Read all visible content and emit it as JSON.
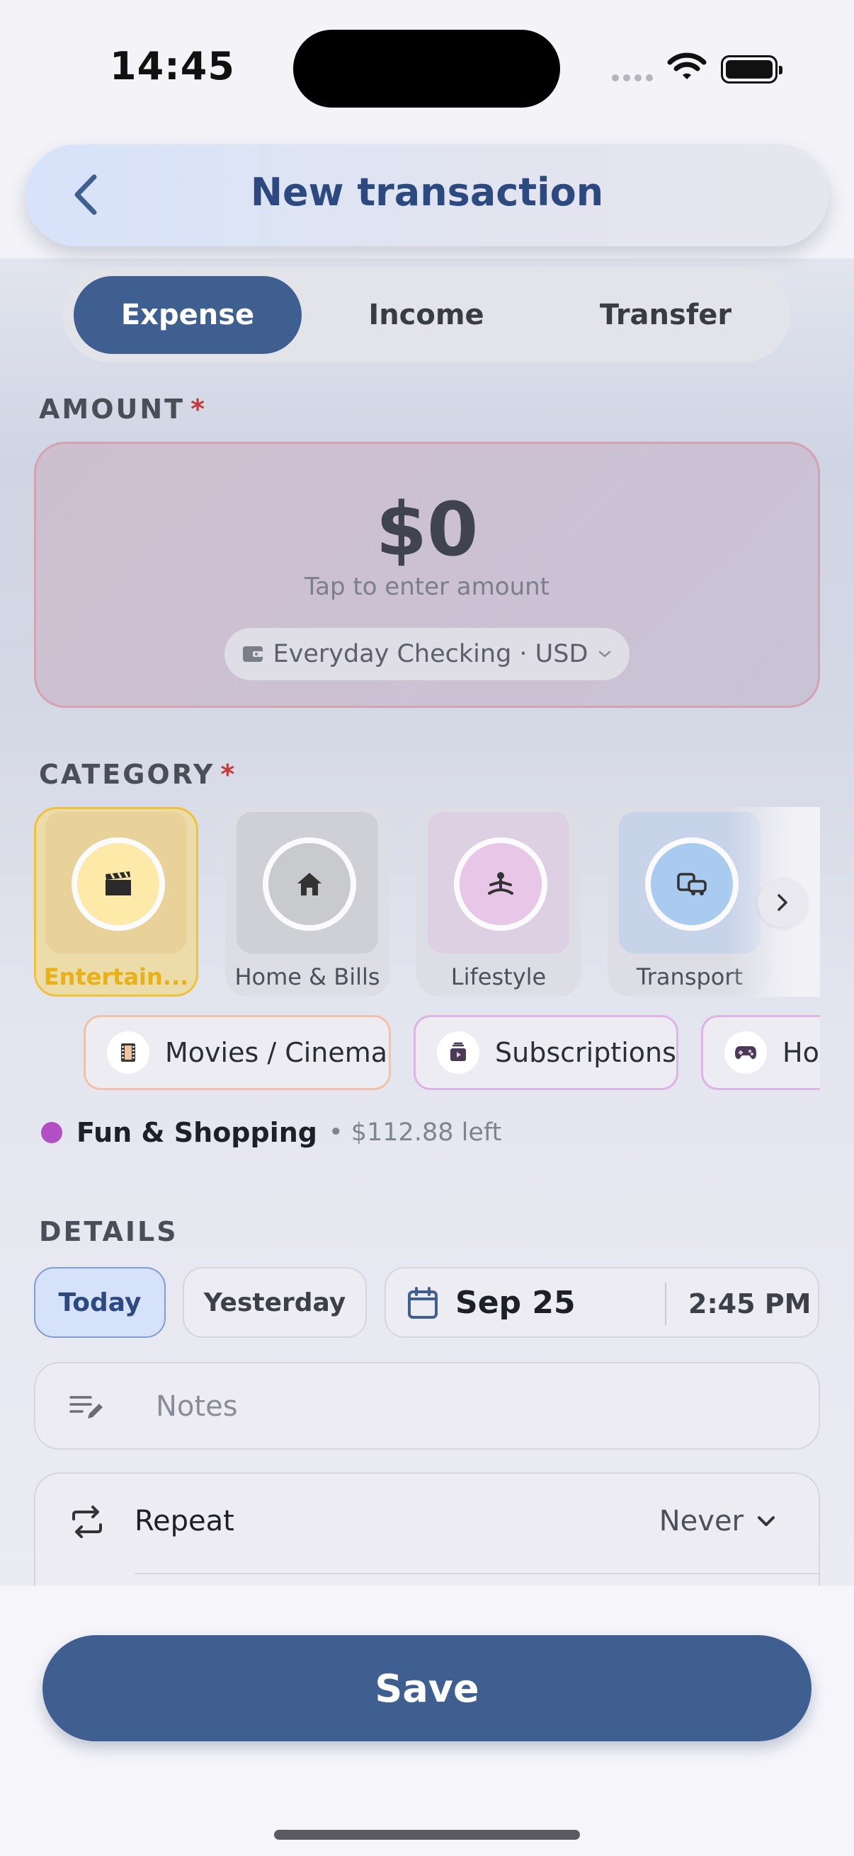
{
  "status_bar": {
    "time": "14:45"
  },
  "header": {
    "title": "New transaction"
  },
  "type_tabs": [
    {
      "label": "Expense",
      "active": true
    },
    {
      "label": "Income",
      "active": false
    },
    {
      "label": "Transfer",
      "active": false
    }
  ],
  "amount": {
    "label": "AMOUNT",
    "required_mark": "*",
    "value": "$0",
    "hint": "Tap to enter amount",
    "account": "Everyday Checking · USD"
  },
  "category": {
    "label": "CATEGORY",
    "required_mark": "*",
    "items": [
      {
        "label": "Entertain...",
        "icon": "clapperboard-icon",
        "selected": true,
        "color": "#fdeaa8"
      },
      {
        "label": "Home & Bills",
        "icon": "home-icon",
        "selected": false,
        "color": "#c9cace"
      },
      {
        "label": "Lifestyle",
        "icon": "meditation-icon",
        "selected": false,
        "color": "#e7c6e8"
      },
      {
        "label": "Transport",
        "icon": "vehicles-icon",
        "selected": false,
        "color": "#a9cbef"
      }
    ],
    "subcategories": [
      {
        "label": "Movies / Cinema",
        "icon": "film-icon",
        "border": "#f2c2a8"
      },
      {
        "label": "Subscriptions",
        "icon": "subscription-icon",
        "border": "#dfb3e6"
      },
      {
        "label": "Hobbies",
        "icon": "gamepad-icon",
        "border": "#dfb3e6"
      }
    ],
    "budget": {
      "name": "Fun & Shopping",
      "left": "• $112.88 left",
      "color": "#b24fc4"
    }
  },
  "details": {
    "label": "DETAILS",
    "quick_dates": [
      {
        "label": "Today",
        "active": true
      },
      {
        "label": "Yesterday",
        "active": false
      }
    ],
    "date": "Sep 25",
    "time": "2:45 PM",
    "notes_placeholder": "Notes",
    "repeat": {
      "label": "Repeat",
      "value": "Never"
    }
  },
  "save_label": "Save",
  "colors": {
    "accent": "#3e5f8f",
    "required": "#c23a3a",
    "selected_category": "#f0c23a"
  }
}
